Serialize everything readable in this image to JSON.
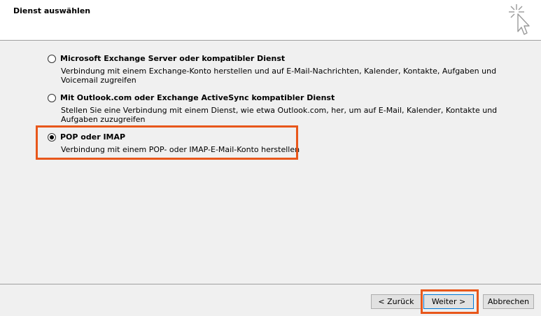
{
  "header": {
    "title": "Dienst auswählen",
    "icon": "cursor-sparkle-icon"
  },
  "options": [
    {
      "title": "Microsoft Exchange Server oder kompatibler Dienst",
      "description": "Verbindung mit einem Exchange-Konto herstellen und auf E-Mail-Nachrichten, Kalender, Kontakte, Aufgaben und Voicemail zugreifen",
      "selected": false
    },
    {
      "title": "Mit Outlook.com oder Exchange ActiveSync kompatibler Dienst",
      "description": "Stellen Sie eine Verbindung mit einem Dienst, wie etwa Outlook.com, her, um auf E-Mail, Kalender, Kontakte und Aufgaben zuzugreifen",
      "selected": false
    },
    {
      "title": "POP oder IMAP",
      "description": "Verbindung mit einem POP- oder IMAP-E-Mail-Konto herstellen",
      "selected": true
    }
  ],
  "footer": {
    "back_label": "< Zurück",
    "next_label": "Weiter >",
    "cancel_label": "Abbrechen"
  },
  "colors": {
    "highlight": "#e8571b",
    "primary_border": "#0078d7"
  }
}
